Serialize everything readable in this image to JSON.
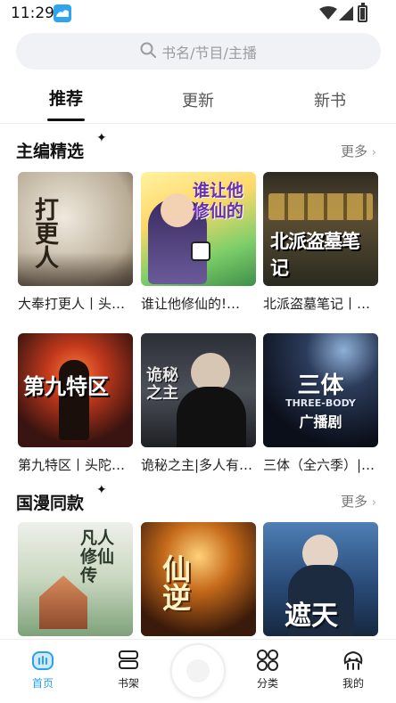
{
  "status": {
    "time": "11:29"
  },
  "search": {
    "placeholder": "书名/节目/主播"
  },
  "tabs": [
    {
      "label": "推荐",
      "active": true
    },
    {
      "label": "更新",
      "active": false
    },
    {
      "label": "新书",
      "active": false
    }
  ],
  "sections": [
    {
      "title": "主编精选",
      "more_label": "更多",
      "books": [
        {
          "title": "大奉打更人丨头…"
        },
        {
          "title": "谁让他修仙的!…"
        },
        {
          "title": "北派盗墓笔记丨…"
        },
        {
          "title": "第九特区丨头陀…"
        },
        {
          "title": "诡秘之主|多人有…"
        },
        {
          "title": "三体（全六季）|…"
        }
      ]
    },
    {
      "title": "国漫同款",
      "more_label": "更多",
      "books": [
        {
          "title": "凡人修仙传"
        },
        {
          "title": "仙逆"
        },
        {
          "title": "遮天"
        }
      ]
    }
  ],
  "covers": {
    "c1": "打更人",
    "c2": "谁让他修仙的",
    "c3": "北派盗墓笔记",
    "c4": "第九特区",
    "c5": "诡秘之主",
    "c6": "三体",
    "c6_sub": "THREE-BODY",
    "c6_sub2": "广播剧",
    "c7": "凡人修仙传",
    "c8": "仙逆",
    "c9": "遮天"
  },
  "bottom_nav": [
    {
      "label": "首页",
      "icon": "home-icon",
      "active": true
    },
    {
      "label": "书架",
      "icon": "bookshelf-icon",
      "active": false
    },
    {
      "label": "分类",
      "icon": "category-icon",
      "active": false
    },
    {
      "label": "我的",
      "icon": "profile-icon",
      "active": false
    }
  ],
  "colors": {
    "accent": "#2aa0f0",
    "highlight": "#bfe7ff"
  }
}
